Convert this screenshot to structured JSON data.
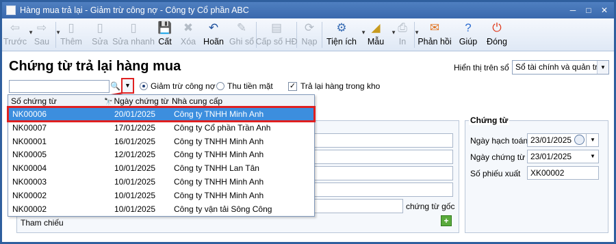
{
  "window": {
    "title": "Hàng mua trả lại - Giảm trừ công nợ - Công ty Cổ phần ABC",
    "controls": {
      "minimize": "─",
      "maximize": "□",
      "close": "✕"
    }
  },
  "toolbar": {
    "items": [
      {
        "label": "Trước",
        "icon": "arrow-left-icon",
        "glyph": "⇦",
        "enabled": false
      },
      {
        "label": "Sau",
        "icon": "arrow-right-icon",
        "glyph": "⇨",
        "enabled": false
      },
      {
        "label": "Thêm",
        "icon": "add-doc-icon",
        "glyph": "▯",
        "enabled": false
      },
      {
        "label": "Sửa",
        "icon": "edit-doc-icon",
        "glyph": "▯",
        "enabled": false
      },
      {
        "label": "Sửa nhanh",
        "icon": "quick-edit-icon",
        "glyph": "▯",
        "enabled": false
      },
      {
        "label": "Cất",
        "icon": "save-icon",
        "glyph": "💾",
        "enabled": true
      },
      {
        "label": "Xóa",
        "icon": "delete-icon",
        "glyph": "✖",
        "enabled": false
      },
      {
        "label": "Hoãn",
        "icon": "undo-icon",
        "glyph": "↶",
        "enabled": true
      },
      {
        "label": "Ghi sổ",
        "icon": "post-icon",
        "glyph": "✎",
        "enabled": false
      },
      {
        "label": "Cấp số HĐ",
        "icon": "invoice-number-icon",
        "glyph": "▤",
        "enabled": false
      },
      {
        "label": "Nạp",
        "icon": "reload-icon",
        "glyph": "⟳",
        "enabled": false
      },
      {
        "label": "Tiện ích",
        "icon": "utilities-icon",
        "glyph": "⚙",
        "enabled": true
      },
      {
        "label": "Mẫu",
        "icon": "template-icon",
        "glyph": "◢",
        "enabled": true
      },
      {
        "label": "In",
        "icon": "print-icon",
        "glyph": "⎙",
        "enabled": false
      },
      {
        "label": "Phản hồi",
        "icon": "feedback-icon",
        "glyph": "✉",
        "enabled": true
      },
      {
        "label": "Giúp",
        "icon": "help-icon",
        "glyph": "?",
        "enabled": true
      },
      {
        "label": "Đóng",
        "icon": "close-icon",
        "glyph": "⏻",
        "enabled": true
      }
    ]
  },
  "header": {
    "title": "Chứng từ trả lại hàng mua",
    "display_label": "Hiển thị trên sổ",
    "display_value": "Sổ tài chính và quản trị"
  },
  "options": {
    "radio_reduce_debt": "Giảm trừ công nợ",
    "radio_collect_cash": "Thu tiền mặt",
    "checkbox_return_stock": "Trả lại hàng trong kho"
  },
  "dropdown": {
    "columns": [
      "Số chứng từ",
      "Ngày chứng từ",
      "Nhà cung cấp"
    ],
    "rows": [
      {
        "so": "NK00006",
        "ngay": "20/01/2025",
        "ncc": "Công ty TNHH Minh Anh",
        "selected": true
      },
      {
        "so": "NK00007",
        "ngay": "17/01/2025",
        "ncc": "Công ty Cổ phần Trần Anh",
        "selected": false
      },
      {
        "so": "NK00001",
        "ngay": "16/01/2025",
        "ncc": "Công ty TNHH Minh Anh",
        "selected": false
      },
      {
        "so": "NK00005",
        "ngay": "12/01/2025",
        "ncc": "Công ty TNHH Minh Anh",
        "selected": false
      },
      {
        "so": "NK00004",
        "ngay": "10/01/2025",
        "ncc": "Công ty TNHH Lan Tân",
        "selected": false
      },
      {
        "so": "NK00003",
        "ngay": "10/01/2025",
        "ncc": "Công ty TNHH Minh Anh",
        "selected": false
      },
      {
        "so": "NK00002",
        "ngay": "10/01/2025",
        "ncc": "Công ty TNHH Minh Anh",
        "selected": false
      },
      {
        "so": "NK00002",
        "ngay": "10/01/2025",
        "ncc": "Công ty vận tải Sông Công",
        "selected": false
      }
    ]
  },
  "general": {
    "original_docs_label": "chứng từ gốc",
    "reference_label": "Tham chiếu"
  },
  "voucher": {
    "group_title": "Chứng từ",
    "posting_date_label": "Ngày hạch toán",
    "posting_date": "23/01/2025",
    "doc_date_label": "Ngày chứng từ",
    "doc_date": "23/01/2025",
    "issue_no_label": "Số phiếu xuất",
    "issue_no": "XK00002"
  }
}
